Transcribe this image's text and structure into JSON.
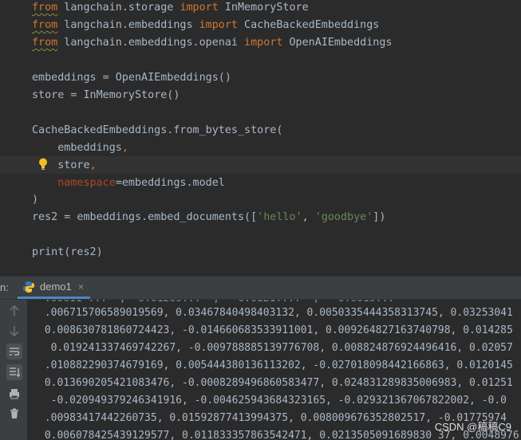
{
  "editor": {
    "imports": [
      {
        "kw1": "from",
        "mod": " langchain.storage ",
        "kw2": "import",
        "name": " InMemoryStore"
      },
      {
        "kw1": "from",
        "mod": " langchain.embeddings ",
        "kw2": "import",
        "name": " CacheBackedEmbeddings"
      },
      {
        "kw1": "from",
        "mod": " langchain.embeddings.openai ",
        "kw2": "import",
        "name": " OpenAIEmbeddings"
      }
    ],
    "l5": "embeddings = OpenAIEmbeddings()",
    "l6": "store = InMemoryStore()",
    "l8": "CacheBackedEmbeddings.from_bytes_store(",
    "l9_text": "    embeddings",
    "l9_comma": ",",
    "l10_text": "    store",
    "l10_comma": ",",
    "l11_indent": "    ",
    "l11_param": "namespace",
    "l11_rest": "=embeddings.model",
    "l12": ")",
    "l13_a": "res2 = embeddings.embed_documents([",
    "l13_s1": "'hello'",
    "l13_sep": ", ",
    "l13_s2": "'goodbye'",
    "l13_b": "])",
    "l15": "print(res2)"
  },
  "runbar": {
    "prefix": "n:",
    "tab_label": "demo1",
    "close": "×"
  },
  "console": {
    "lines": [
      " .006715706589019569, 0.03467840498403132, 0.0050335444358313745, 0.03253041",
      " 0.008630781860724423, -0.014660683533911001, 0.009264827163740798, 0.014285",
      "  0.019241337469742267, -0.009788885139776708, 0.008824876924496416, 0.02057",
      " .010882290374679169, 0.005444380136113202, -0.027018098442166863, 0.0120145",
      " 0.013690205421083476, -0.0008289496860583477, 0.024831289835006983, 0.01251",
      "  -0.020949379246341916, -0.004625943684323165, -0.029321367067822002, -0.0",
      " .00983417442260735, 0.01592877413994375, 0.008009676352802517, -0.01775974",
      " 0.006078425439129577, 0.011833357863542471, 0.0213505091689830 37, 0.0048976"
    ]
  },
  "watermark": "CSDN @稿稿C9",
  "colors": {
    "bg": "#2b2b2b",
    "keyword": "#cc7832",
    "string": "#6a8759",
    "param": "#aa4926",
    "text": "#a9b7c6",
    "tab_underline": "#4a88c7"
  }
}
